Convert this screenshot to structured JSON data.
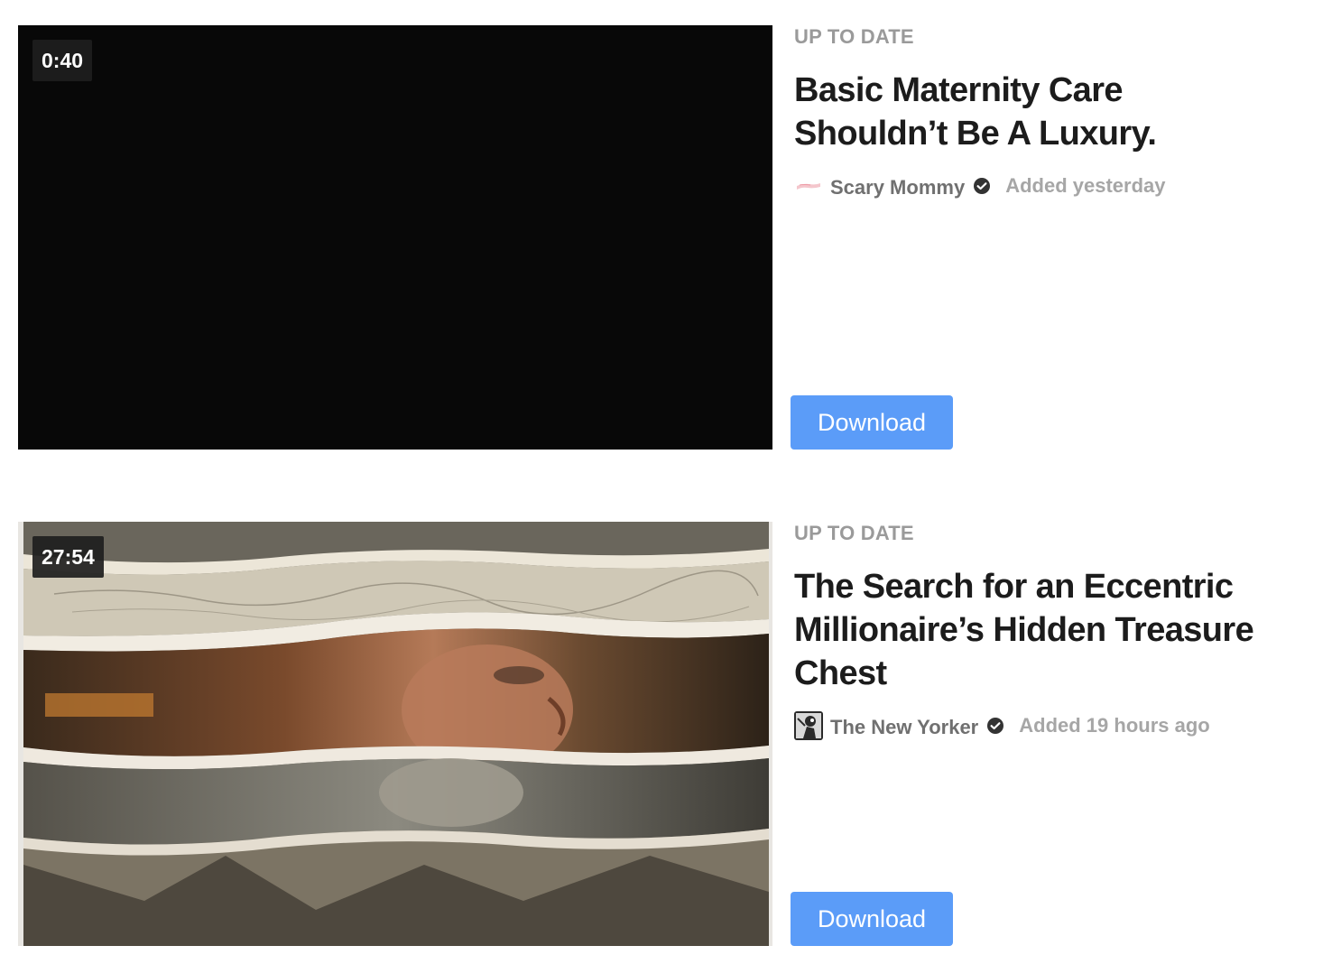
{
  "videos": [
    {
      "duration": "0:40",
      "category": "UP TO DATE",
      "title": "Basic Maternity Care Shouldn’t Be A Luxury.",
      "publisher": "Scary Mommy",
      "added": "Added yesterday",
      "download_label": "Download",
      "thumbnail": "black-frame"
    },
    {
      "duration": "27:54",
      "category": "UP TO DATE",
      "title": "The Search for an Eccentric Millionaire’s Hidden Treasure Chest",
      "publisher": "The New Yorker",
      "added": "Added 19 hours ago",
      "download_label": "Download",
      "thumbnail": "torn-paper-collage-man-map"
    }
  ],
  "colors": {
    "button": "#5b9cf8",
    "title": "#1c1c1c",
    "category": "#9a9a9a",
    "publisher": "#707070",
    "added": "#a6a6a6"
  }
}
